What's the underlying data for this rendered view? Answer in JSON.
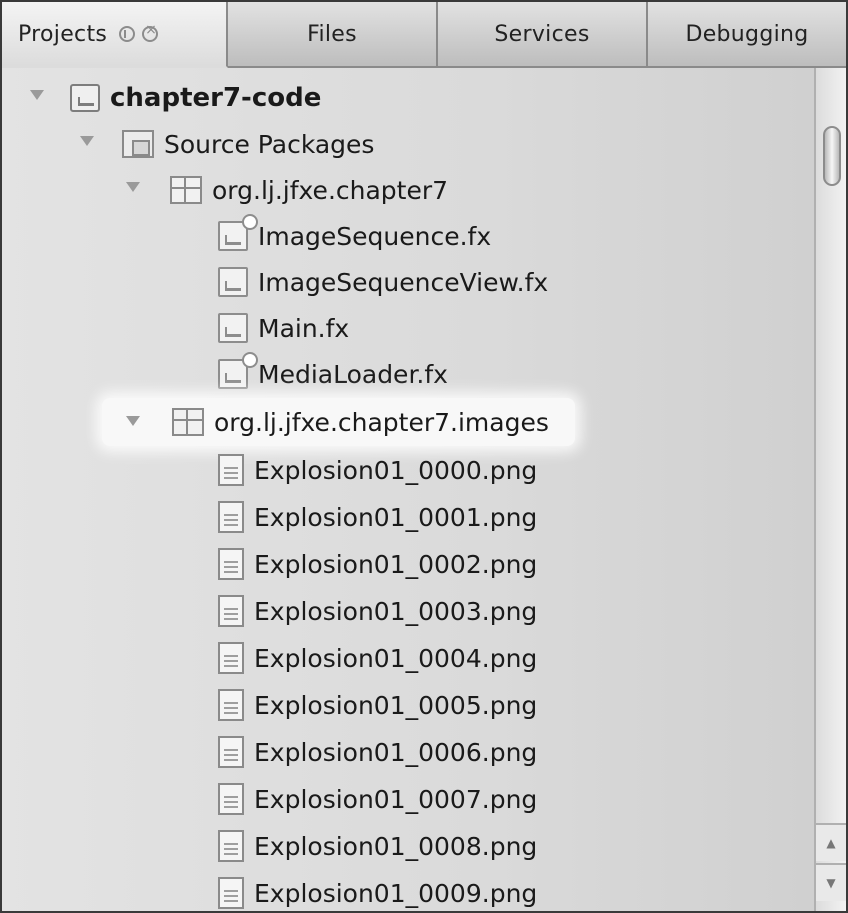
{
  "tabs": [
    {
      "label": "Projects",
      "active": true
    },
    {
      "label": "Files",
      "active": false
    },
    {
      "label": "Services",
      "active": false
    },
    {
      "label": "Debugging",
      "active": false
    }
  ],
  "tree": {
    "project": "chapter7-code",
    "source_packages": "Source Packages",
    "package1": {
      "name": "org.lj.jfxe.chapter7",
      "files": [
        "ImageSequence.fx",
        "ImageSequenceView.fx",
        "Main.fx",
        "MediaLoader.fx"
      ]
    },
    "package2": {
      "name": "org.lj.jfxe.chapter7.images",
      "files": [
        "Explosion01_0000.png",
        "Explosion01_0001.png",
        "Explosion01_0002.png",
        "Explosion01_0003.png",
        "Explosion01_0004.png",
        "Explosion01_0005.png",
        "Explosion01_0006.png",
        "Explosion01_0007.png",
        "Explosion01_0008.png",
        "Explosion01_0009.png"
      ]
    }
  },
  "scroll": {
    "up": "▲",
    "down": "▼"
  }
}
